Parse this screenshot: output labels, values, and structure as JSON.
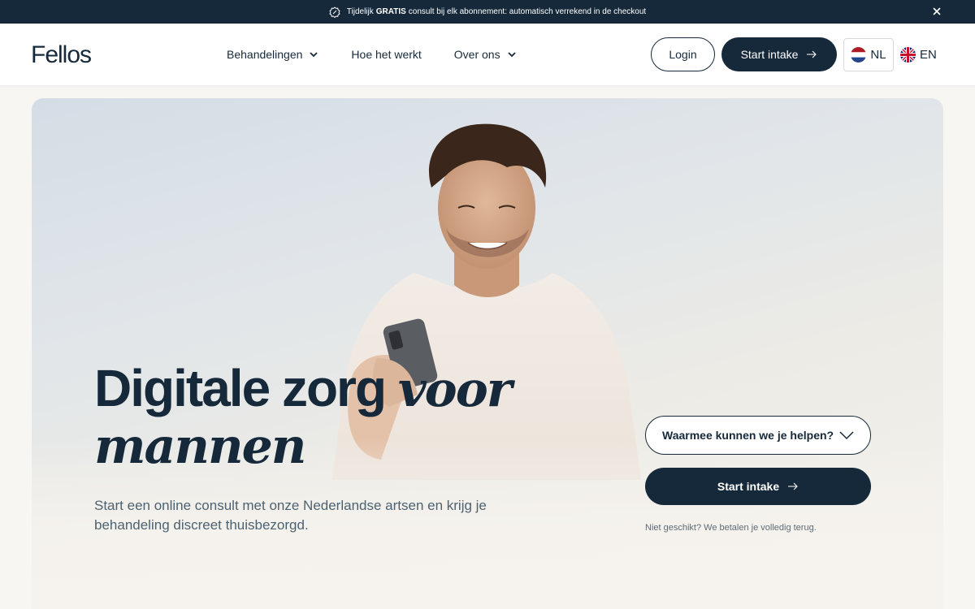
{
  "announcement": {
    "prefix": "Tijdelijk",
    "bold": "GRATIS",
    "suffix": "consult bij elk abonnement: automatisch verrekend in de checkout",
    "icon": "badge-icon",
    "close_icon": "close-icon"
  },
  "header": {
    "logo": "Fellos",
    "nav": [
      {
        "label": "Behandelingen",
        "has_dropdown": true
      },
      {
        "label": "Hoe het werkt",
        "has_dropdown": false
      },
      {
        "label": "Over ons",
        "has_dropdown": true
      }
    ],
    "login_label": "Login",
    "start_label": "Start intake",
    "languages": [
      {
        "code": "NL",
        "flag": "netherlands-flag-icon",
        "selected": true
      },
      {
        "code": "EN",
        "flag": "uk-flag-icon",
        "selected": false
      }
    ]
  },
  "hero": {
    "headline_plain": "Digitale zorg",
    "headline_italic": "voor mannen",
    "subtext": "Start een online consult met onze Nederlandse artsen en krijg je behandeling discreet thuisbezorgd.",
    "select_label": "Waarmee kunnen we je helpen?",
    "start_label": "Start intake",
    "guarantee": "Niet geschikt? We betalen je volledig terug."
  },
  "colors": {
    "navy": "#15293a",
    "text_muted": "#4d6271",
    "background": "#f7f6f3"
  }
}
